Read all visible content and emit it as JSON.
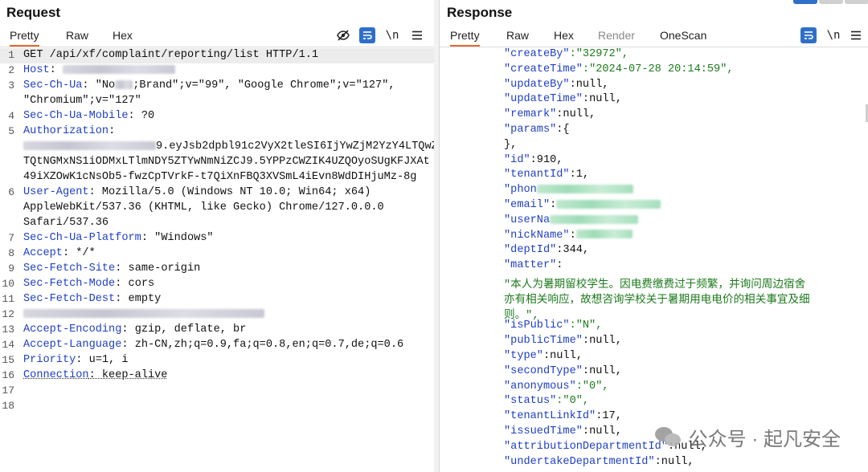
{
  "request": {
    "title": "Request",
    "tabs": [
      {
        "label": "Pretty",
        "active": true
      },
      {
        "label": "Raw",
        "active": false
      },
      {
        "label": "Hex",
        "active": false
      }
    ],
    "toolbar": {
      "hide_icon": "eye-off-icon",
      "wrap_icon": "wrap-lines-icon",
      "newline_label": "\\n",
      "menu_icon": "hamburger-menu-icon"
    },
    "lines": [
      {
        "n": "1",
        "key": "GET /api/xf/complaint/reporting/list HTTP/1.1",
        "val": ""
      },
      {
        "n": "2",
        "key": "Host",
        "val": ": "
      },
      {
        "n": "3",
        "key": "Sec-Ch-Ua",
        "val": ": \"No",
        "val2": ";Brand\";v=\"99\", \"Google Chrome\";v=\"127\","
      },
      {
        "n": "",
        "key": "",
        "val": "\"Chromium\";v=\"127\""
      },
      {
        "n": "4",
        "key": "Sec-Ch-Ua-Mobile",
        "val": ": ?0"
      },
      {
        "n": "5",
        "key": "Authorization",
        "val": ":"
      },
      {
        "n": "",
        "key": "",
        "val": "9.eyJsb2dpbl91c2VyX2tleSI6IjYwZjM2YzY4LTQwZ"
      },
      {
        "n": "",
        "key": "",
        "val": "TQtNGMxNS1iODMxLTlmNDY5ZTYwNmNiZCJ9.5YPPzCWZIK4UZQOyoSUgKFJXAt"
      },
      {
        "n": "",
        "key": "",
        "val": "49iXZOwK1cNsOb5-fwzCpTVrkF-t7QiXnFBQ3XVSmL4iEvn8WdDIHjuMz-8g"
      },
      {
        "n": "6",
        "key": "User-Agent",
        "val": ": Mozilla/5.0 (Windows NT 10.0; Win64; x64)"
      },
      {
        "n": "",
        "key": "",
        "val": "AppleWebKit/537.36 (KHTML, like Gecko) Chrome/127.0.0.0"
      },
      {
        "n": "",
        "key": "",
        "val": "Safari/537.36"
      },
      {
        "n": "7",
        "key": "Sec-Ch-Ua-Platform",
        "val": ": \"Windows\""
      },
      {
        "n": "8",
        "key": "Accept",
        "val": ": */*"
      },
      {
        "n": "9",
        "key": "Sec-Fetch-Site",
        "val": ": same-origin"
      },
      {
        "n": "10",
        "key": "Sec-Fetch-Mode",
        "val": ": cors"
      },
      {
        "n": "11",
        "key": "Sec-Fetch-Dest",
        "val": ": empty"
      },
      {
        "n": "12",
        "key": "",
        "val": ""
      },
      {
        "n": "13",
        "key": "Accept-Encoding",
        "val": ": gzip, deflate, br"
      },
      {
        "n": "14",
        "key": "Accept-Language",
        "val": ": zh-CN,zh;q=0.9,fa;q=0.8,en;q=0.7,de;q=0.6"
      },
      {
        "n": "15",
        "key": "Priority",
        "val": ": u=1, i"
      },
      {
        "n": "16",
        "key": "Connection",
        "val": ": keep-alive"
      },
      {
        "n": "17",
        "key": "",
        "val": ""
      },
      {
        "n": "18",
        "key": "",
        "val": ""
      }
    ]
  },
  "response": {
    "title": "Response",
    "tabs": [
      {
        "label": "Pretty",
        "active": true
      },
      {
        "label": "Raw",
        "active": false
      },
      {
        "label": "Hex",
        "active": false
      },
      {
        "label": "Render",
        "active": false,
        "disabled": true
      },
      {
        "label": "OneScan",
        "active": false
      }
    ],
    "toolbar": {
      "wrap_icon": "wrap-lines-icon",
      "newline_label": "\\n",
      "menu_icon": "hamburger-menu-icon"
    },
    "lines": [
      {
        "k": "\"createBy\"",
        "v": ":\"32972\",",
        "vc": "str"
      },
      {
        "k": "\"createTime\"",
        "v": ":\"2024-07-28 20:14:59\",",
        "vc": "str"
      },
      {
        "k": "\"updateBy\"",
        "v": ":null,",
        "vc": "plain"
      },
      {
        "k": "\"updateTime\"",
        "v": ":null,",
        "vc": "plain"
      },
      {
        "k": "\"remark\"",
        "v": ":null,",
        "vc": "plain"
      },
      {
        "k": "\"params\"",
        "v": ":{",
        "vc": "plain"
      },
      {
        "k": "",
        "v": "},",
        "vc": "plain"
      },
      {
        "k": "\"id\"",
        "v": ":910,",
        "vc": "plain"
      },
      {
        "k": "\"tenantId\"",
        "v": ":1,",
        "vc": "plain"
      },
      {
        "k": "\"phon",
        "v": "",
        "vc": "blur"
      },
      {
        "k": "\"email\"",
        "v": ":",
        "vc": "blur"
      },
      {
        "k": "\"userNa",
        "v": "",
        "vc": "blur"
      },
      {
        "k": "\"nickName\"",
        "v": ":",
        "vc": "blur"
      },
      {
        "k": "\"deptId\"",
        "v": ":344,",
        "vc": "plain"
      },
      {
        "k": "\"matter\"",
        "v": ":",
        "vc": "plain"
      },
      {
        "k": "",
        "v": "\"本人为暑期留校学生。因电费缴费过于频繁，并询问周边宿舍",
        "vc": "green"
      },
      {
        "k": "",
        "v": "亦有相关响应，故想咨询学校关于暑期用电电价的相关事宜及细",
        "vc": "green"
      },
      {
        "k": "",
        "v": "则。\",",
        "vc": "green"
      },
      {
        "k": "\"isPublic\"",
        "v": ":\"N\",",
        "vc": "str"
      },
      {
        "k": "\"publicTime\"",
        "v": ":null,",
        "vc": "plain"
      },
      {
        "k": "\"type\"",
        "v": ":null,",
        "vc": "plain"
      },
      {
        "k": "\"secondType\"",
        "v": ":null,",
        "vc": "plain"
      },
      {
        "k": "\"anonymous\"",
        "v": ":\"0\",",
        "vc": "str"
      },
      {
        "k": "\"status\"",
        "v": ":\"0\",",
        "vc": "str"
      },
      {
        "k": "\"tenantLinkId\"",
        "v": ":17,",
        "vc": "plain"
      },
      {
        "k": "\"issuedTime\"",
        "v": ":null,",
        "vc": "plain"
      },
      {
        "k": "\"attributionDepartmentId\"",
        "v": ":null,",
        "vc": "plain"
      },
      {
        "k": "\"undertakeDepartmentId\"",
        "v": ":null,",
        "vc": "plain"
      }
    ]
  },
  "watermark": {
    "text": "公众号 · 起凡安全"
  }
}
